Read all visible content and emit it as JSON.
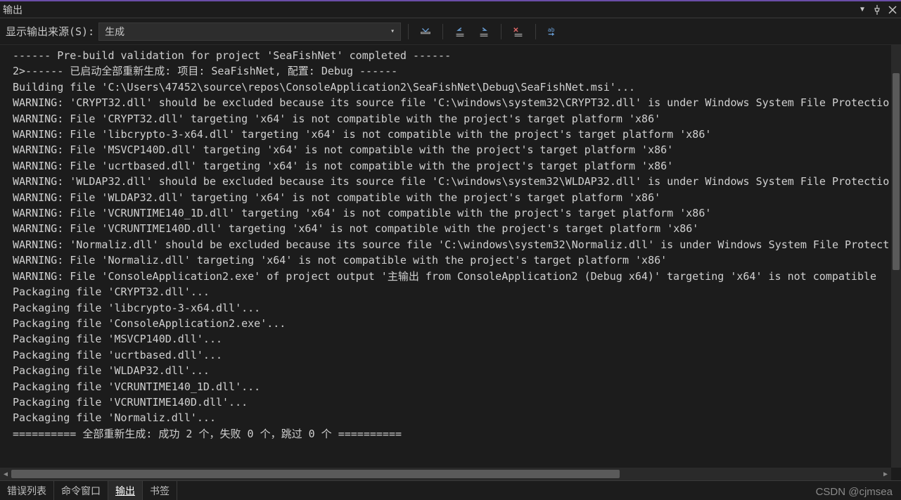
{
  "title": "输出",
  "toolbar": {
    "label": "显示输出来源(S):",
    "selected": "生成"
  },
  "output_lines": [
    "------ Pre-build validation for project 'SeaFishNet' completed ------",
    "2>------ 已启动全部重新生成: 项目: SeaFishNet, 配置: Debug ------",
    "Building file 'C:\\Users\\47452\\source\\repos\\ConsoleApplication2\\SeaFishNet\\Debug\\SeaFishNet.msi'...",
    "WARNING: 'CRYPT32.dll' should be excluded because its source file 'C:\\windows\\system32\\CRYPT32.dll' is under Windows System File Protectio",
    "WARNING: File 'CRYPT32.dll' targeting 'x64' is not compatible with the project's target platform 'x86'",
    "WARNING: File 'libcrypto-3-x64.dll' targeting 'x64' is not compatible with the project's target platform 'x86'",
    "WARNING: File 'MSVCP140D.dll' targeting 'x64' is not compatible with the project's target platform 'x86'",
    "WARNING: File 'ucrtbased.dll' targeting 'x64' is not compatible with the project's target platform 'x86'",
    "WARNING: 'WLDAP32.dll' should be excluded because its source file 'C:\\windows\\system32\\WLDAP32.dll' is under Windows System File Protectio",
    "WARNING: File 'WLDAP32.dll' targeting 'x64' is not compatible with the project's target platform 'x86'",
    "WARNING: File 'VCRUNTIME140_1D.dll' targeting 'x64' is not compatible with the project's target platform 'x86'",
    "WARNING: File 'VCRUNTIME140D.dll' targeting 'x64' is not compatible with the project's target platform 'x86'",
    "WARNING: 'Normaliz.dll' should be excluded because its source file 'C:\\windows\\system32\\Normaliz.dll' is under Windows System File Protect",
    "WARNING: File 'Normaliz.dll' targeting 'x64' is not compatible with the project's target platform 'x86'",
    "WARNING: File 'ConsoleApplication2.exe' of project output '主输出 from ConsoleApplication2 (Debug x64)' targeting 'x64' is not compatible ",
    "Packaging file 'CRYPT32.dll'...",
    "Packaging file 'libcrypto-3-x64.dll'...",
    "Packaging file 'ConsoleApplication2.exe'...",
    "Packaging file 'MSVCP140D.dll'...",
    "Packaging file 'ucrtbased.dll'...",
    "Packaging file 'WLDAP32.dll'...",
    "Packaging file 'VCRUNTIME140_1D.dll'...",
    "Packaging file 'VCRUNTIME140D.dll'...",
    "Packaging file 'Normaliz.dll'...",
    "========== 全部重新生成: 成功 2 个，失败 0 个，跳过 0 个 =========="
  ],
  "tabs": [
    {
      "label": "错误列表",
      "active": false
    },
    {
      "label": "命令窗口",
      "active": false
    },
    {
      "label": "输出",
      "active": true
    },
    {
      "label": "书签",
      "active": false
    }
  ],
  "watermark": "CSDN @cjmsea"
}
